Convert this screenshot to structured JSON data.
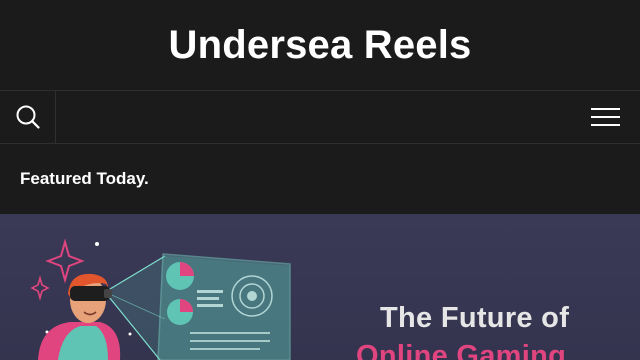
{
  "site": {
    "title": "Undersea Reels"
  },
  "nav": {
    "search_icon": "search-icon",
    "menu_icon": "hamburger-menu-icon"
  },
  "featured": {
    "label": "Featured Today."
  },
  "banner": {
    "headline_line1": "The Future of",
    "headline_line2": "Online Gaming"
  },
  "colors": {
    "background": "#1b1b1b",
    "banner_background": "#3a3a57",
    "accent_pink": "#e0457f",
    "accent_teal": "#5fc4b3"
  }
}
